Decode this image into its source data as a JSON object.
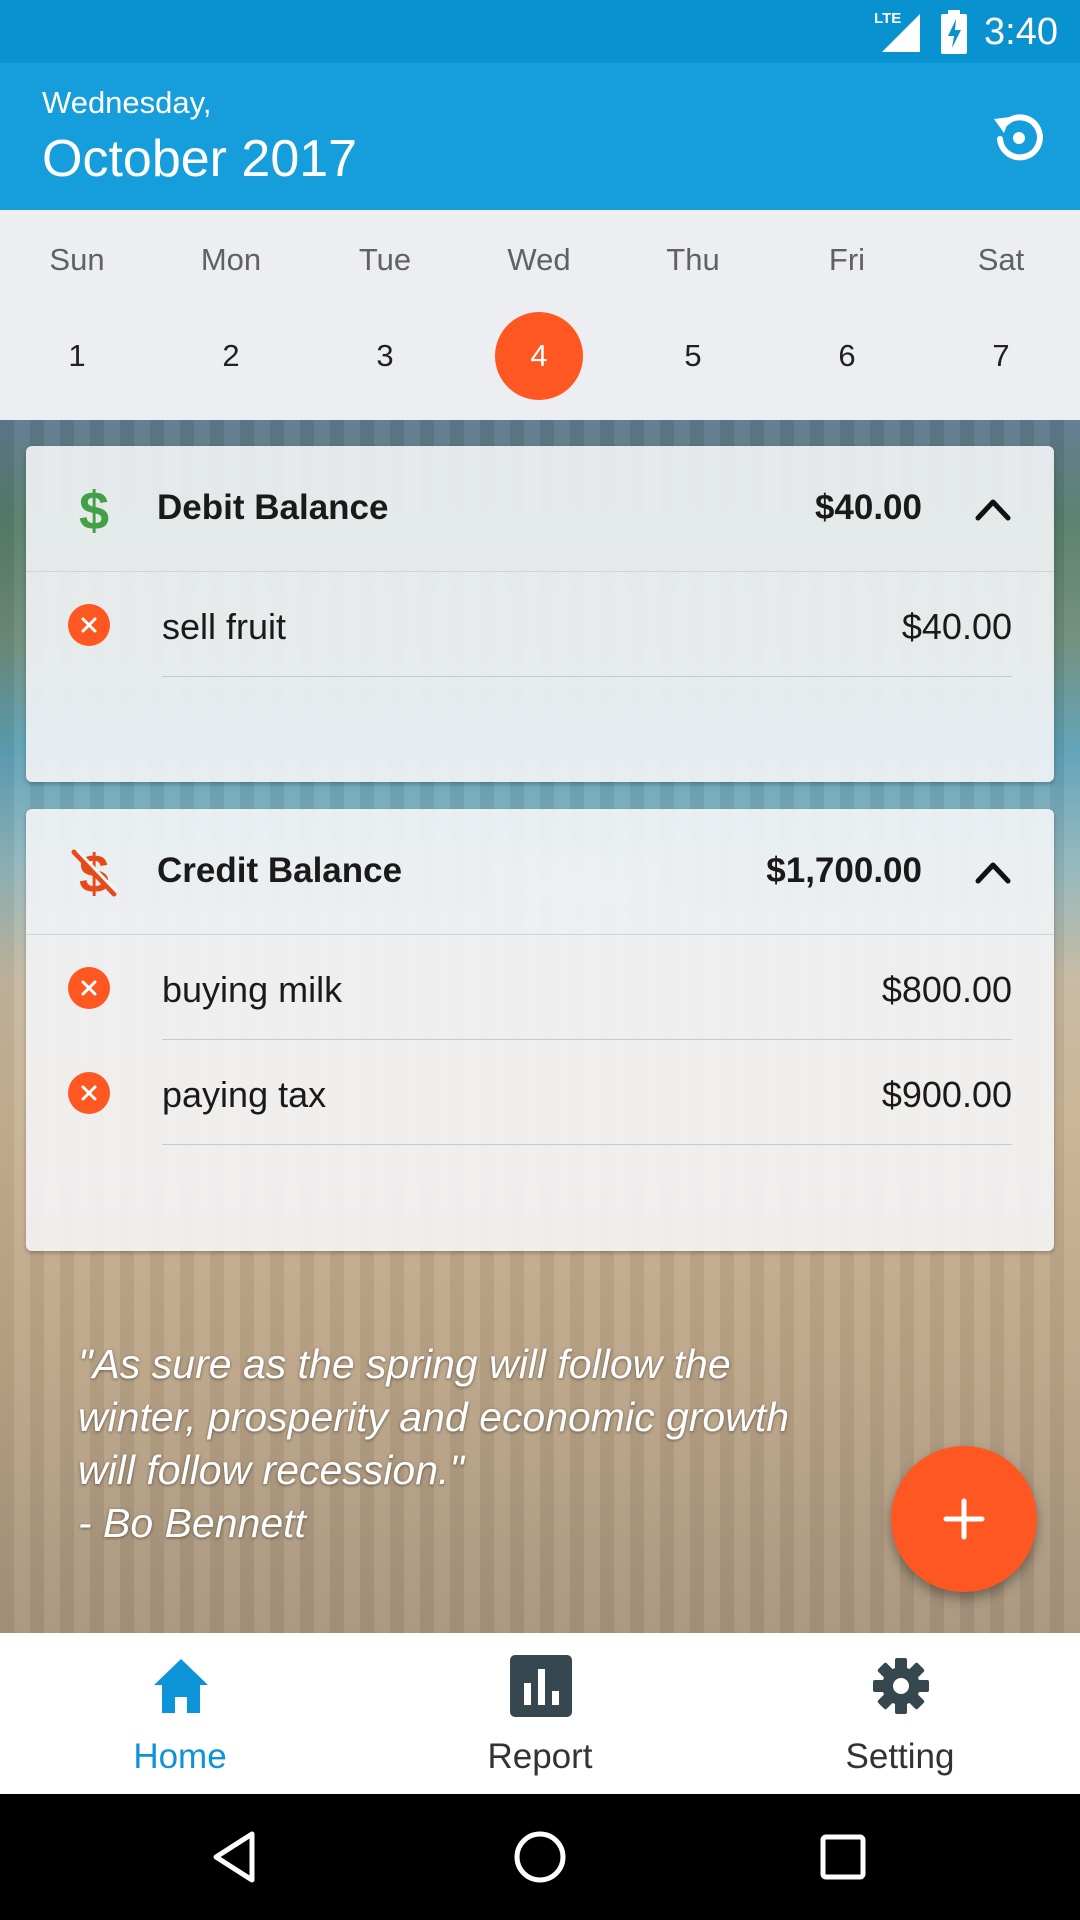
{
  "status_bar": {
    "network": "LTE",
    "time": "3:40",
    "icons": [
      "lte-signal-icon",
      "battery-charging-icon"
    ]
  },
  "header": {
    "weekday": "Wednesday,",
    "month_year": "October 2017",
    "reset_icon": "restore-icon"
  },
  "week": {
    "days": [
      {
        "name": "Sun",
        "num": "1"
      },
      {
        "name": "Mon",
        "num": "2"
      },
      {
        "name": "Tue",
        "num": "3"
      },
      {
        "name": "Wed",
        "num": "4"
      },
      {
        "name": "Thu",
        "num": "5"
      },
      {
        "name": "Fri",
        "num": "6"
      },
      {
        "name": "Sat",
        "num": "7"
      }
    ],
    "selected": "4"
  },
  "debit": {
    "title": "Debit Balance",
    "total": "$40.00",
    "items": [
      {
        "label": "sell fruit",
        "amount": "$40.00"
      }
    ]
  },
  "credit": {
    "title": "Credit Balance",
    "total": "$1,700.00",
    "items": [
      {
        "label": "buying milk",
        "amount": "$800.00"
      },
      {
        "label": "paying tax",
        "amount": "$900.00"
      }
    ]
  },
  "quote": {
    "text": "\"As sure as the spring will follow the\nwinter, prosperity and economic growth\nwill follow recession.\"\n- Bo Bennett"
  },
  "nav": {
    "items": [
      {
        "label": "Home",
        "icon": "home-icon"
      },
      {
        "label": "Report",
        "icon": "bar-chart-icon"
      },
      {
        "label": "Setting",
        "icon": "gear-icon"
      }
    ],
    "active": "Home"
  },
  "colors": {
    "accent": "#ff5722",
    "primary": "#169ddc",
    "status_bar": "#0892d0",
    "active_tab": "#0d94d8",
    "debit_icon": "#43a047",
    "credit_icon": "#e64a19"
  }
}
